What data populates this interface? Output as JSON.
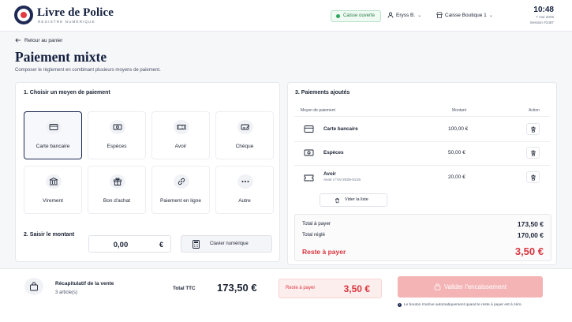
{
  "brand": {
    "name": "Livre de Police",
    "tagline": "REGISTRE NUMÉRIQUE"
  },
  "topbar": {
    "register_status": "Caisse ouverte",
    "user": "Eryss B.",
    "shop": "Caisse Boutique 1",
    "time": "10:48",
    "date": "7 mai 2025",
    "session": "Session #2487"
  },
  "header": {
    "back_label": "Retour au panier",
    "title": "Paiement mixte",
    "subtitle": "Composer le règlement en combinant plusieurs moyens de paiement."
  },
  "methods": {
    "title": "1. Choisir un moyen de paiement",
    "selected": "Carte bancaire",
    "items": [
      {
        "label": "Carte bancaire",
        "icon": "credit-card-icon"
      },
      {
        "label": "Espèces",
        "icon": "banknote-icon"
      },
      {
        "label": "Avoir",
        "icon": "ticket-icon"
      },
      {
        "label": "Chèque",
        "icon": "cheque-icon"
      },
      {
        "label": "Virement",
        "icon": "bank-icon"
      },
      {
        "label": "Bon d'achat",
        "icon": "gift-icon"
      },
      {
        "label": "Paiement en ligne",
        "icon": "link-icon"
      },
      {
        "label": "Autre",
        "icon": "more-icon"
      }
    ]
  },
  "amount": {
    "title": "2. Saisir le montant",
    "value": "0,00",
    "currency": "€",
    "keypad_label": "Clavier numérique"
  },
  "added": {
    "title": "3. Paiements ajoutés",
    "columns": {
      "method": "Moyen de paiement",
      "amount": "Montant",
      "action": "Action"
    },
    "rows": [
      {
        "name": "Carte bancaire",
        "sub": "",
        "amount": "100,00 €",
        "icon": "credit-card-icon"
      },
      {
        "name": "Espèces",
        "sub": "",
        "amount": "50,00 €",
        "icon": "banknote-icon"
      },
      {
        "name": "Avoir",
        "sub": "Avoir n°AV-2025-0215",
        "amount": "20,00 €",
        "icon": "ticket-icon"
      }
    ],
    "clear_label": "Vider la liste"
  },
  "totals": {
    "to_pay_label": "Total à payer",
    "to_pay": "173,50 €",
    "paid_label": "Total réglé",
    "paid": "170,00 €",
    "remaining_label": "Reste à payer",
    "remaining": "3,50 €"
  },
  "footer": {
    "recap_title": "Récapitulatif de la vente",
    "recap_count": "3 article(s)",
    "ttc_label": "Total TTC",
    "ttc_value": "173,50 €",
    "rest_label": "Reste à payer",
    "rest_value": "3,50 €",
    "validate_label": "Valider l'encaissement",
    "hint": "Le bouton s'active automatiquement quand le reste à payer est à zéro."
  },
  "colors": {
    "navy": "#1e2a55",
    "accent_red": "#d9363e",
    "success_green": "#2fa85d",
    "disabled_button": "#f4b4b5"
  }
}
